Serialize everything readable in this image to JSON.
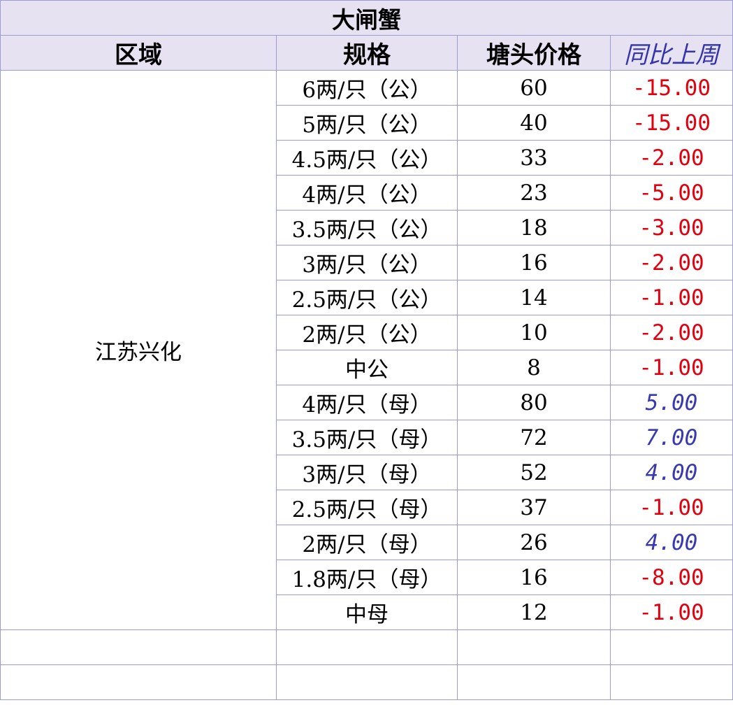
{
  "title": "大闸蟹",
  "headers": {
    "region": "区域",
    "spec": "规格",
    "price": "塘头价格",
    "change": "同比上周"
  },
  "region": "江苏兴化",
  "rows": [
    {
      "spec": "6两/只（公）",
      "price": "60",
      "change": "-15.00",
      "dir": "neg"
    },
    {
      "spec": "5两/只（公）",
      "price": "40",
      "change": "-15.00",
      "dir": "neg"
    },
    {
      "spec": "4.5两/只（公）",
      "price": "33",
      "change": "-2.00",
      "dir": "neg"
    },
    {
      "spec": "4两/只（公）",
      "price": "23",
      "change": "-5.00",
      "dir": "neg"
    },
    {
      "spec": "3.5两/只（公）",
      "price": "18",
      "change": "-3.00",
      "dir": "neg"
    },
    {
      "spec": "3两/只（公）",
      "price": "16",
      "change": "-2.00",
      "dir": "neg"
    },
    {
      "spec": "2.5两/只（公）",
      "price": "14",
      "change": "-1.00",
      "dir": "neg"
    },
    {
      "spec": "2两/只（公）",
      "price": "10",
      "change": "-2.00",
      "dir": "neg"
    },
    {
      "spec": "中公",
      "price": "8",
      "change": "-1.00",
      "dir": "neg"
    },
    {
      "spec": "4两/只（母）",
      "price": "80",
      "change": "5.00",
      "dir": "pos"
    },
    {
      "spec": "3.5两/只（母）",
      "price": "72",
      "change": "7.00",
      "dir": "pos"
    },
    {
      "spec": "3两/只（母）",
      "price": "52",
      "change": "4.00",
      "dir": "pos"
    },
    {
      "spec": "2.5两/只（母）",
      "price": "37",
      "change": "-1.00",
      "dir": "neg"
    },
    {
      "spec": "2两/只（母）",
      "price": "26",
      "change": "4.00",
      "dir": "pos"
    },
    {
      "spec": "1.8两/只（母）",
      "price": "16",
      "change": "-8.00",
      "dir": "neg"
    },
    {
      "spec": "中母",
      "price": "12",
      "change": "-1.00",
      "dir": "neg"
    }
  ],
  "colors": {
    "header_bg": "#e6e2f2",
    "grid": "#9b9bd6",
    "negative": "#e0000f",
    "positive": "#3838b0"
  }
}
